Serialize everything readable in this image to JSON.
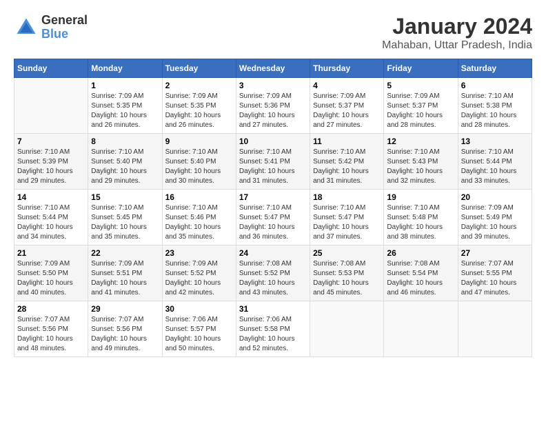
{
  "logo": {
    "line1": "General",
    "line2": "Blue"
  },
  "title": "January 2024",
  "subtitle": "Mahaban, Uttar Pradesh, India",
  "weekdays": [
    "Sunday",
    "Monday",
    "Tuesday",
    "Wednesday",
    "Thursday",
    "Friday",
    "Saturday"
  ],
  "weeks": [
    [
      {
        "day": "",
        "info": ""
      },
      {
        "day": "1",
        "info": "Sunrise: 7:09 AM\nSunset: 5:35 PM\nDaylight: 10 hours\nand 26 minutes."
      },
      {
        "day": "2",
        "info": "Sunrise: 7:09 AM\nSunset: 5:35 PM\nDaylight: 10 hours\nand 26 minutes."
      },
      {
        "day": "3",
        "info": "Sunrise: 7:09 AM\nSunset: 5:36 PM\nDaylight: 10 hours\nand 27 minutes."
      },
      {
        "day": "4",
        "info": "Sunrise: 7:09 AM\nSunset: 5:37 PM\nDaylight: 10 hours\nand 27 minutes."
      },
      {
        "day": "5",
        "info": "Sunrise: 7:09 AM\nSunset: 5:37 PM\nDaylight: 10 hours\nand 28 minutes."
      },
      {
        "day": "6",
        "info": "Sunrise: 7:10 AM\nSunset: 5:38 PM\nDaylight: 10 hours\nand 28 minutes."
      }
    ],
    [
      {
        "day": "7",
        "info": "Sunrise: 7:10 AM\nSunset: 5:39 PM\nDaylight: 10 hours\nand 29 minutes."
      },
      {
        "day": "8",
        "info": "Sunrise: 7:10 AM\nSunset: 5:40 PM\nDaylight: 10 hours\nand 29 minutes."
      },
      {
        "day": "9",
        "info": "Sunrise: 7:10 AM\nSunset: 5:40 PM\nDaylight: 10 hours\nand 30 minutes."
      },
      {
        "day": "10",
        "info": "Sunrise: 7:10 AM\nSunset: 5:41 PM\nDaylight: 10 hours\nand 31 minutes."
      },
      {
        "day": "11",
        "info": "Sunrise: 7:10 AM\nSunset: 5:42 PM\nDaylight: 10 hours\nand 31 minutes."
      },
      {
        "day": "12",
        "info": "Sunrise: 7:10 AM\nSunset: 5:43 PM\nDaylight: 10 hours\nand 32 minutes."
      },
      {
        "day": "13",
        "info": "Sunrise: 7:10 AM\nSunset: 5:44 PM\nDaylight: 10 hours\nand 33 minutes."
      }
    ],
    [
      {
        "day": "14",
        "info": "Sunrise: 7:10 AM\nSunset: 5:44 PM\nDaylight: 10 hours\nand 34 minutes."
      },
      {
        "day": "15",
        "info": "Sunrise: 7:10 AM\nSunset: 5:45 PM\nDaylight: 10 hours\nand 35 minutes."
      },
      {
        "day": "16",
        "info": "Sunrise: 7:10 AM\nSunset: 5:46 PM\nDaylight: 10 hours\nand 35 minutes."
      },
      {
        "day": "17",
        "info": "Sunrise: 7:10 AM\nSunset: 5:47 PM\nDaylight: 10 hours\nand 36 minutes."
      },
      {
        "day": "18",
        "info": "Sunrise: 7:10 AM\nSunset: 5:47 PM\nDaylight: 10 hours\nand 37 minutes."
      },
      {
        "day": "19",
        "info": "Sunrise: 7:10 AM\nSunset: 5:48 PM\nDaylight: 10 hours\nand 38 minutes."
      },
      {
        "day": "20",
        "info": "Sunrise: 7:09 AM\nSunset: 5:49 PM\nDaylight: 10 hours\nand 39 minutes."
      }
    ],
    [
      {
        "day": "21",
        "info": "Sunrise: 7:09 AM\nSunset: 5:50 PM\nDaylight: 10 hours\nand 40 minutes."
      },
      {
        "day": "22",
        "info": "Sunrise: 7:09 AM\nSunset: 5:51 PM\nDaylight: 10 hours\nand 41 minutes."
      },
      {
        "day": "23",
        "info": "Sunrise: 7:09 AM\nSunset: 5:52 PM\nDaylight: 10 hours\nand 42 minutes."
      },
      {
        "day": "24",
        "info": "Sunrise: 7:08 AM\nSunset: 5:52 PM\nDaylight: 10 hours\nand 43 minutes."
      },
      {
        "day": "25",
        "info": "Sunrise: 7:08 AM\nSunset: 5:53 PM\nDaylight: 10 hours\nand 45 minutes."
      },
      {
        "day": "26",
        "info": "Sunrise: 7:08 AM\nSunset: 5:54 PM\nDaylight: 10 hours\nand 46 minutes."
      },
      {
        "day": "27",
        "info": "Sunrise: 7:07 AM\nSunset: 5:55 PM\nDaylight: 10 hours\nand 47 minutes."
      }
    ],
    [
      {
        "day": "28",
        "info": "Sunrise: 7:07 AM\nSunset: 5:56 PM\nDaylight: 10 hours\nand 48 minutes."
      },
      {
        "day": "29",
        "info": "Sunrise: 7:07 AM\nSunset: 5:56 PM\nDaylight: 10 hours\nand 49 minutes."
      },
      {
        "day": "30",
        "info": "Sunrise: 7:06 AM\nSunset: 5:57 PM\nDaylight: 10 hours\nand 50 minutes."
      },
      {
        "day": "31",
        "info": "Sunrise: 7:06 AM\nSunset: 5:58 PM\nDaylight: 10 hours\nand 52 minutes."
      },
      {
        "day": "",
        "info": ""
      },
      {
        "day": "",
        "info": ""
      },
      {
        "day": "",
        "info": ""
      }
    ]
  ]
}
